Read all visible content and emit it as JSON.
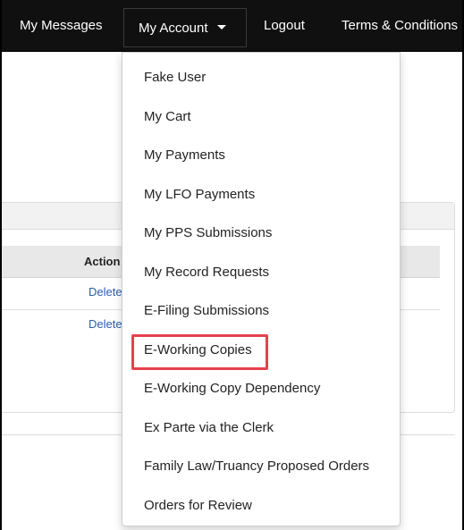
{
  "navbar": {
    "items": [
      {
        "label": "My Messages"
      },
      {
        "label": "My Account"
      },
      {
        "label": "Logout"
      },
      {
        "label": "Terms & Conditions"
      }
    ]
  },
  "table": {
    "action_header": "Action",
    "rows": [
      {
        "action": "Delete"
      },
      {
        "action": "Delete"
      }
    ]
  },
  "dropdown": {
    "items": [
      {
        "label": "Fake User"
      },
      {
        "label": "My Cart"
      },
      {
        "label": "My Payments"
      },
      {
        "label": "My LFO Payments"
      },
      {
        "label": "My PPS Submissions"
      },
      {
        "label": "My Record Requests"
      },
      {
        "label": "E-Filing Submissions"
      },
      {
        "label": "E-Working Copies",
        "highlighted": true
      },
      {
        "label": "E-Working Copy Dependency"
      },
      {
        "label": "Ex Parte via the Clerk"
      },
      {
        "label": "Family Law/Truancy Proposed Orders"
      },
      {
        "label": "Orders for Review"
      }
    ]
  },
  "colors": {
    "navbar_bg": "#101010",
    "highlight": "#e4424d",
    "link": "#2a5db0"
  }
}
